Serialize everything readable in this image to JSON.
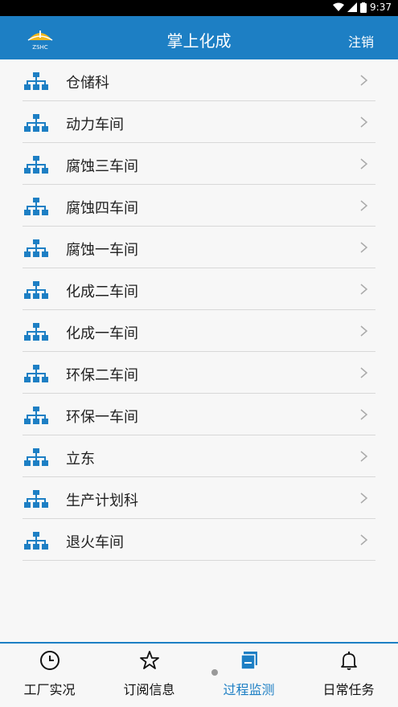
{
  "status_bar": {
    "time": "9:37"
  },
  "header": {
    "title": "掌上化成",
    "logout_label": "注销",
    "logo_text": "ZSHC"
  },
  "list": {
    "items": [
      {
        "label": "仓储科"
      },
      {
        "label": "动力车间"
      },
      {
        "label": "腐蚀三车间"
      },
      {
        "label": "腐蚀四车间"
      },
      {
        "label": "腐蚀一车间"
      },
      {
        "label": "化成二车间"
      },
      {
        "label": "化成一车间"
      },
      {
        "label": "环保二车间"
      },
      {
        "label": "环保一车间"
      },
      {
        "label": "立东"
      },
      {
        "label": "生产计划科"
      },
      {
        "label": "退火车间"
      }
    ]
  },
  "tabs": [
    {
      "label": "工厂实况",
      "icon": "clock-icon"
    },
    {
      "label": "订阅信息",
      "icon": "star-icon"
    },
    {
      "label": "过程监测",
      "icon": "document-stack-icon",
      "active": true
    },
    {
      "label": "日常任务",
      "icon": "bell-icon"
    }
  ],
  "colors": {
    "primary": "#1d7fc4",
    "text": "#222222",
    "divider": "#d8d8d8"
  }
}
